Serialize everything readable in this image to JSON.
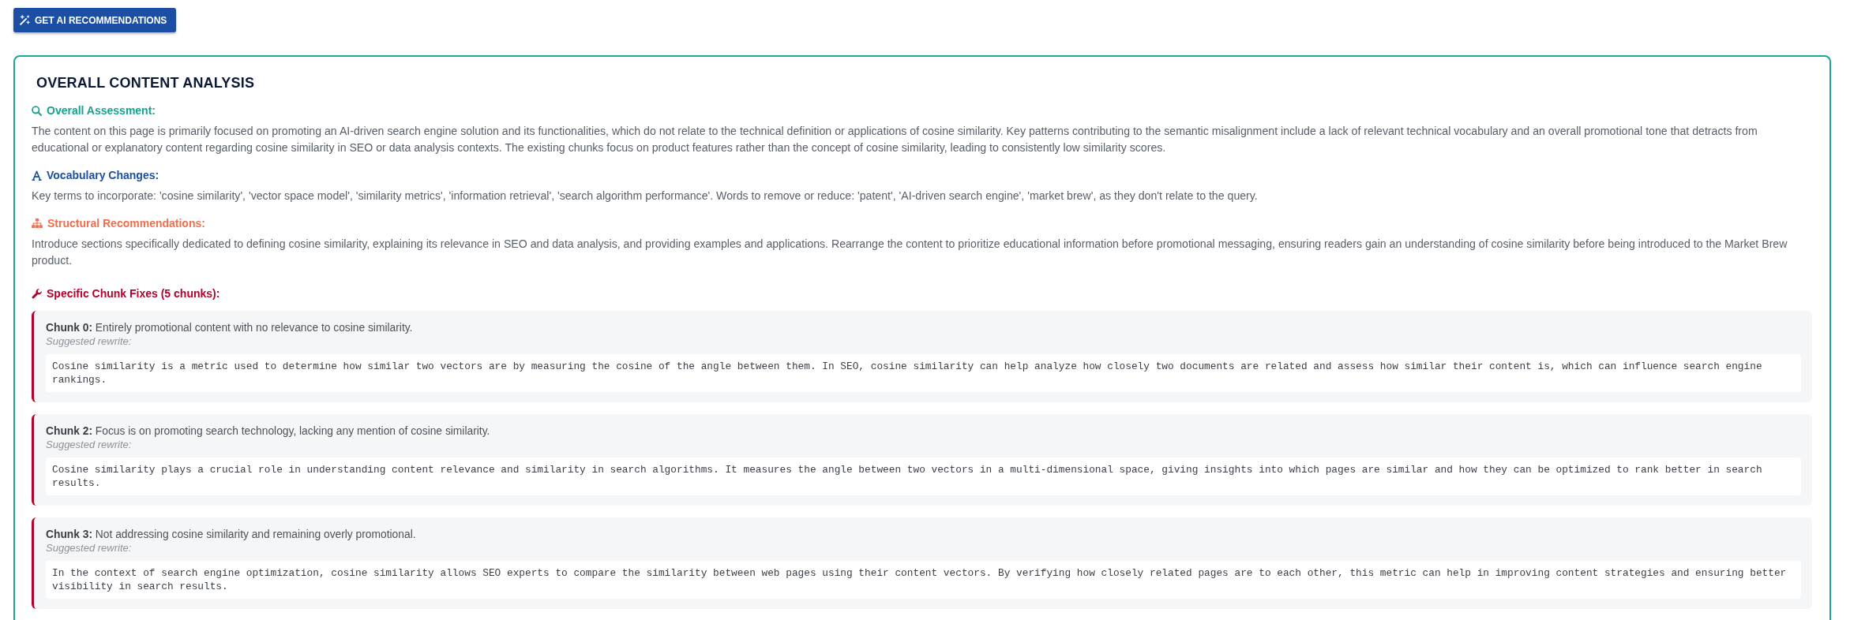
{
  "toolbar": {
    "button": {
      "label": "GET AI RECOMMENDATIONS"
    }
  },
  "analysis": {
    "title": "OVERALL CONTENT ANALYSIS",
    "sections": [
      {
        "kind": "assessment",
        "heading": "Overall Assessment:",
        "text": "The content on this page is primarily focused on promoting an AI-driven search engine solution and its functionalities, which do not relate to the technical definition or applications of cosine similarity. Key patterns contributing to the semantic misalignment include a lack of relevant technical vocabulary and an overall promotional tone that detracts from educational or explanatory content regarding cosine similarity in SEO or data analysis contexts. The existing chunks focus on product features rather than the concept of cosine similarity, leading to consistently low similarity scores."
      },
      {
        "kind": "vocabulary",
        "heading": "Vocabulary Changes:",
        "text": "Key terms to incorporate: 'cosine similarity', 'vector space model', 'similarity metrics', 'information retrieval', 'search algorithm performance'. Words to remove or reduce: 'patent', 'AI-driven search engine', 'market brew', as they don't relate to the query."
      },
      {
        "kind": "structure",
        "heading": "Structural Recommendations:",
        "text": "Introduce sections specifically dedicated to defining cosine similarity, explaining its relevance in SEO and data analysis, and providing examples and applications. Rearrange the content to prioritize educational information before promotional messaging, ensuring readers gain an understanding of cosine similarity before being introduced to the Market Brew product."
      }
    ],
    "chunk_fixes": {
      "heading": "Specific Chunk Fixes (5 chunks):",
      "chunks": [
        {
          "issue": "**Chunk 0:** Entirely promotional content with no relevance to cosine similarity.",
          "rewrite_label": "Suggested rewrite:",
          "rewrite": "Cosine similarity is a metric used to determine how similar two vectors are by measuring the cosine of the angle between them. In SEO, cosine similarity can help analyze how closely two documents are related and assess how similar their content is, which can influence search engine rankings."
        },
        {
          "issue": "**Chunk 2:** Focus is on promoting search technology, lacking any mention of cosine similarity.",
          "rewrite_label": "Suggested rewrite:",
          "rewrite": "Cosine similarity plays a crucial role in understanding content relevance and similarity in search algorithms. It measures the angle between two vectors in a multi-dimensional space, giving insights into which pages are similar and how they can be optimized to rank better in search results."
        },
        {
          "issue": "**Chunk 3:** Not addressing cosine similarity and remaining overly promotional.",
          "rewrite_label": "Suggested rewrite:",
          "rewrite": "In the context of search engine optimization, cosine similarity allows SEO experts to compare the similarity between web pages using their content vectors. By verifying how closely related pages are to each other, this metric can help in improving content strategies and ensuring better visibility in search results."
        }
      ]
    }
  }
}
